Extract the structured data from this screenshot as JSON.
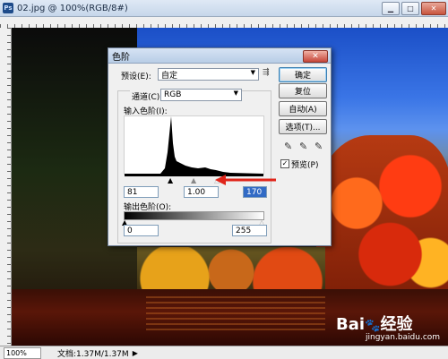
{
  "window": {
    "title": "02.jpg @ 100%(RGB/8#)",
    "ps_badge": "Ps"
  },
  "status": {
    "zoom": "100%",
    "doc_info": "文档:1.37M/1.37M",
    "arrow": "▶"
  },
  "levels": {
    "title": "色阶",
    "preset_label": "预设(E):",
    "preset_value": "自定",
    "channel_label": "通道(C):",
    "channel_value": "RGB",
    "input_label": "输入色阶(I):",
    "input_black": "81",
    "input_gamma": "1.00",
    "input_white": "170",
    "output_label": "输出色阶(O):",
    "output_black": "0",
    "output_white": "255",
    "buttons": {
      "ok": "确定",
      "reset": "复位",
      "auto": "自动(A)",
      "options": "选项(T)..."
    },
    "preview_label": "预览(P)",
    "preview_checked": true
  },
  "watermark": {
    "site": "jingyan.baidu.com",
    "brand": "Bai",
    "brand2": "经验"
  },
  "colors": {
    "accent_arrow": "#e0261b",
    "selected_field": "#316ac5"
  }
}
